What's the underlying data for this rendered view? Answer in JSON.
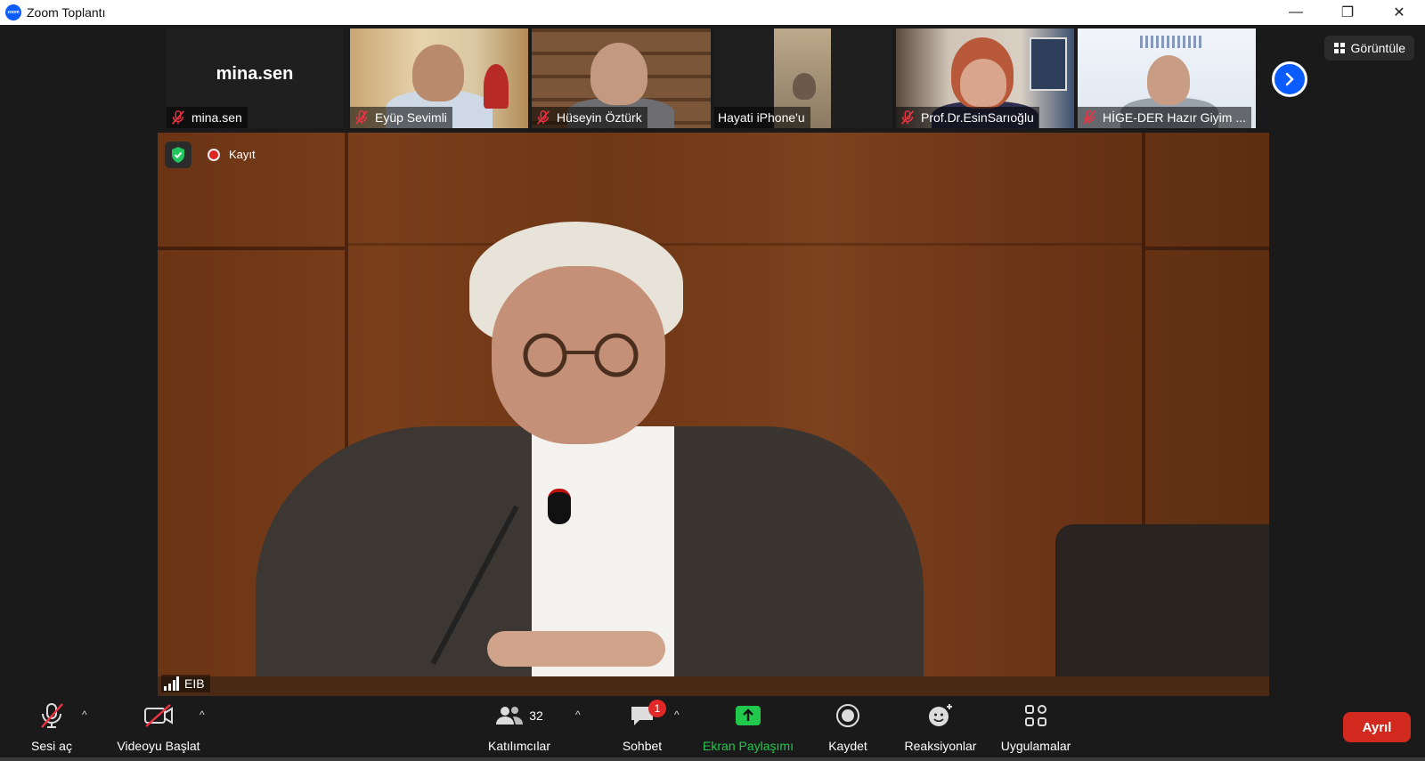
{
  "window": {
    "logo_text": "zoom",
    "title": "Zoom Toplantı",
    "minimize": "—",
    "restore": "❐",
    "close": "✕"
  },
  "view_button": {
    "label": "Görüntüle"
  },
  "participants_strip": [
    {
      "big_name": "mina.sen",
      "label": "mina.sen",
      "muted": true
    },
    {
      "label": "Eyüp Sevimli",
      "muted": true
    },
    {
      "label": "Hüseyin Öztürk",
      "muted": true
    },
    {
      "label": "Hayati iPhone'u",
      "muted": false
    },
    {
      "label": "Prof.Dr.EsinSarıoğlu",
      "muted": true
    },
    {
      "label": "HİGE-DER Hazır Giyim ...",
      "muted": true
    }
  ],
  "main_video": {
    "recording_label": "Kayıt",
    "speaker_name": "EIB"
  },
  "toolbar": {
    "mute_label": "Sesi aç",
    "video_label": "Videoyu Başlat",
    "participants_label": "Katılımcılar",
    "participants_count": "32",
    "chat_label": "Sohbet",
    "chat_badge": "1",
    "share_label": "Ekran Paylaşımı",
    "record_label": "Kaydet",
    "reactions_label": "Reaksiyonlar",
    "apps_label": "Uygulamalar",
    "leave_label": "Ayrıl"
  },
  "colors": {
    "accent": "#0b5cff",
    "share_green": "#20c94c",
    "leave_red": "#d1291e",
    "badge_red": "#e02828"
  }
}
